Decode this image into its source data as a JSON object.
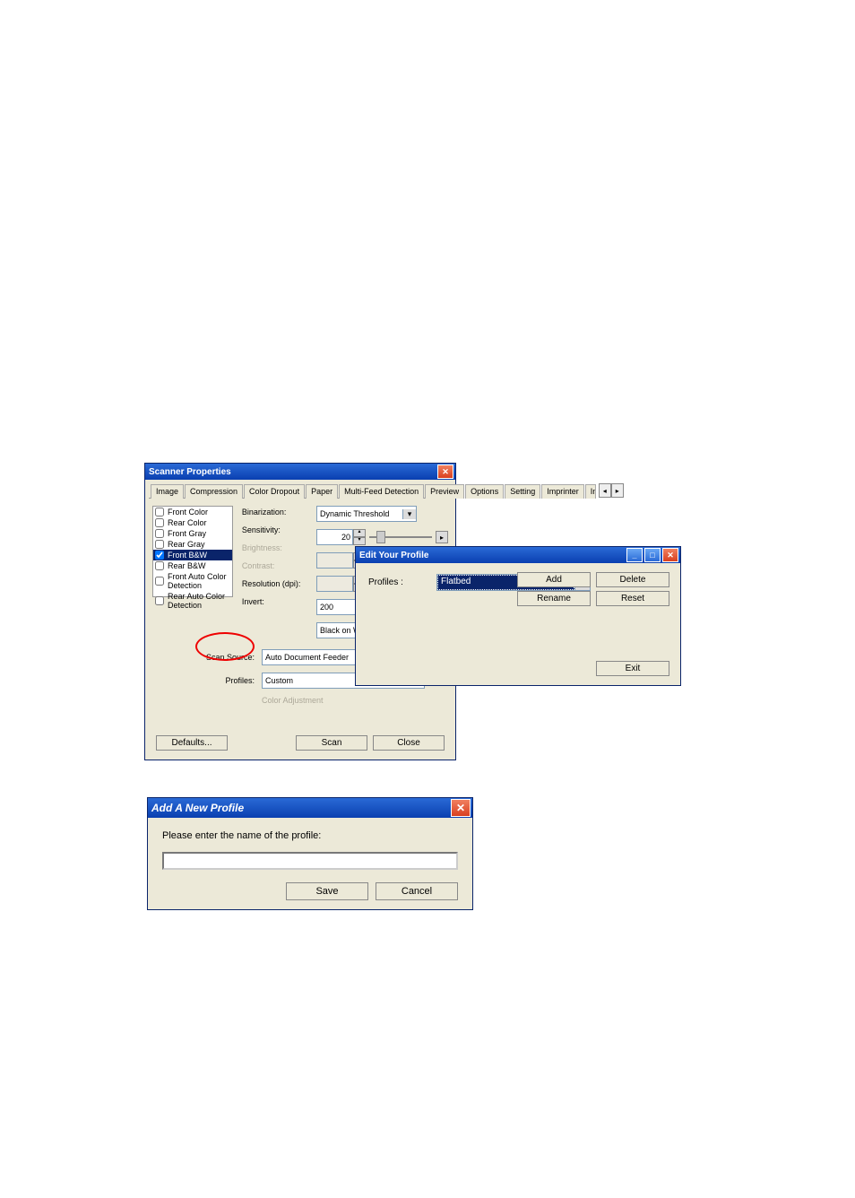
{
  "scanner": {
    "title": "Scanner Properties",
    "tabs": [
      "Image",
      "Compression",
      "Color Dropout",
      "Paper",
      "Multi-Feed Detection",
      "Preview",
      "Options",
      "Setting",
      "Imprinter",
      "Information"
    ],
    "active_tab": 0,
    "image_types": [
      {
        "label": "Front Color",
        "checked": false
      },
      {
        "label": "Rear Color",
        "checked": false
      },
      {
        "label": "Front Gray",
        "checked": false
      },
      {
        "label": "Rear Gray",
        "checked": false
      },
      {
        "label": "Front B&W",
        "checked": true
      },
      {
        "label": "Rear B&W",
        "checked": false
      },
      {
        "label": "Front Auto Color Detection",
        "checked": false
      },
      {
        "label": "Rear Auto Color Detection",
        "checked": false
      }
    ],
    "labels": {
      "binarization": "Binarization:",
      "sensitivity": "Sensitivity:",
      "brightness": "Brightness:",
      "contrast": "Contrast:",
      "resolution": "Resolution (dpi):",
      "invert": "Invert:",
      "scan_source": "Scan Source:",
      "profiles": "Profiles:",
      "color_adjust": "Color Adjustment"
    },
    "values": {
      "binarization": "Dynamic Threshold",
      "sensitivity": "20",
      "resolution": "200",
      "invert": "Black on White",
      "scan_source": "Auto Document Feeder",
      "profiles": "Custom"
    },
    "buttons": {
      "defaults": "Defaults...",
      "scan": "Scan",
      "close": "Close"
    }
  },
  "edit_profile": {
    "title": "Edit Your Profile",
    "label": "Profiles :",
    "selected": "Flatbed",
    "buttons": {
      "add": "Add",
      "delete": "Delete",
      "rename": "Rename",
      "reset": "Reset",
      "exit": "Exit"
    }
  },
  "add_profile": {
    "title": "Add A New Profile",
    "prompt": "Please enter the name of the profile:",
    "value": "",
    "buttons": {
      "save": "Save",
      "cancel": "Cancel"
    }
  }
}
